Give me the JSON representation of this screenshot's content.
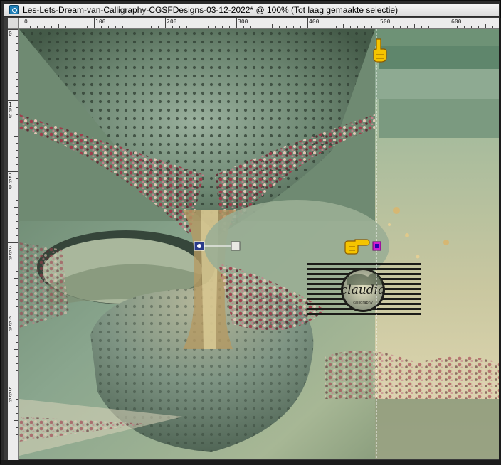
{
  "window": {
    "title": "Les-Lets-Dream-van-Calligraphy-CGSFDesigns-03-12-2022* @ 100% (Tot laag gemaakte selectie)"
  },
  "ruler": {
    "horizontal_labels": [
      "0",
      "100",
      "200",
      "300",
      "400",
      "500",
      "600"
    ],
    "vertical_labels": [
      "0",
      "100",
      "200",
      "300",
      "400",
      "500"
    ]
  },
  "watermark": {
    "text": "claudia",
    "subtext": "calligraphy"
  },
  "colors": {
    "canvas_bg": "#7f9880",
    "guide_line": "#ffffff",
    "guide_handle": "#d01fd0",
    "pointer_hand": "#f5c400"
  },
  "icons": {
    "pointer_top": "hand-pointing-down-icon",
    "pointer_right": "hand-pointing-right-icon",
    "deform_handle": "pick-tool-handle-icon"
  }
}
